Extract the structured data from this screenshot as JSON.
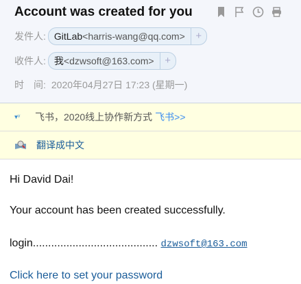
{
  "header": {
    "title": "Account was created for you",
    "from_label": "发件人:",
    "from_name": "GitLab",
    "from_email": "<harris-wang@qq.com>",
    "to_label": "收件人:",
    "to_name": "我",
    "to_email": "<dzwsoft@163.com>",
    "add": "+",
    "time_label": "时　间:",
    "time_value": "2020年04月27日 17:23 (星期一)"
  },
  "ad": {
    "text": "飞书，2020线上协作新方式",
    "link": "飞书>>"
  },
  "translate": {
    "label": "翻译成中文"
  },
  "email": {
    "greeting": "Hi David Dai!",
    "line1": "Your account has been created successfully.",
    "login_label": "login.........................................",
    "login_value": "dzwsoft@163.com",
    "link": "Click here to set your password"
  }
}
